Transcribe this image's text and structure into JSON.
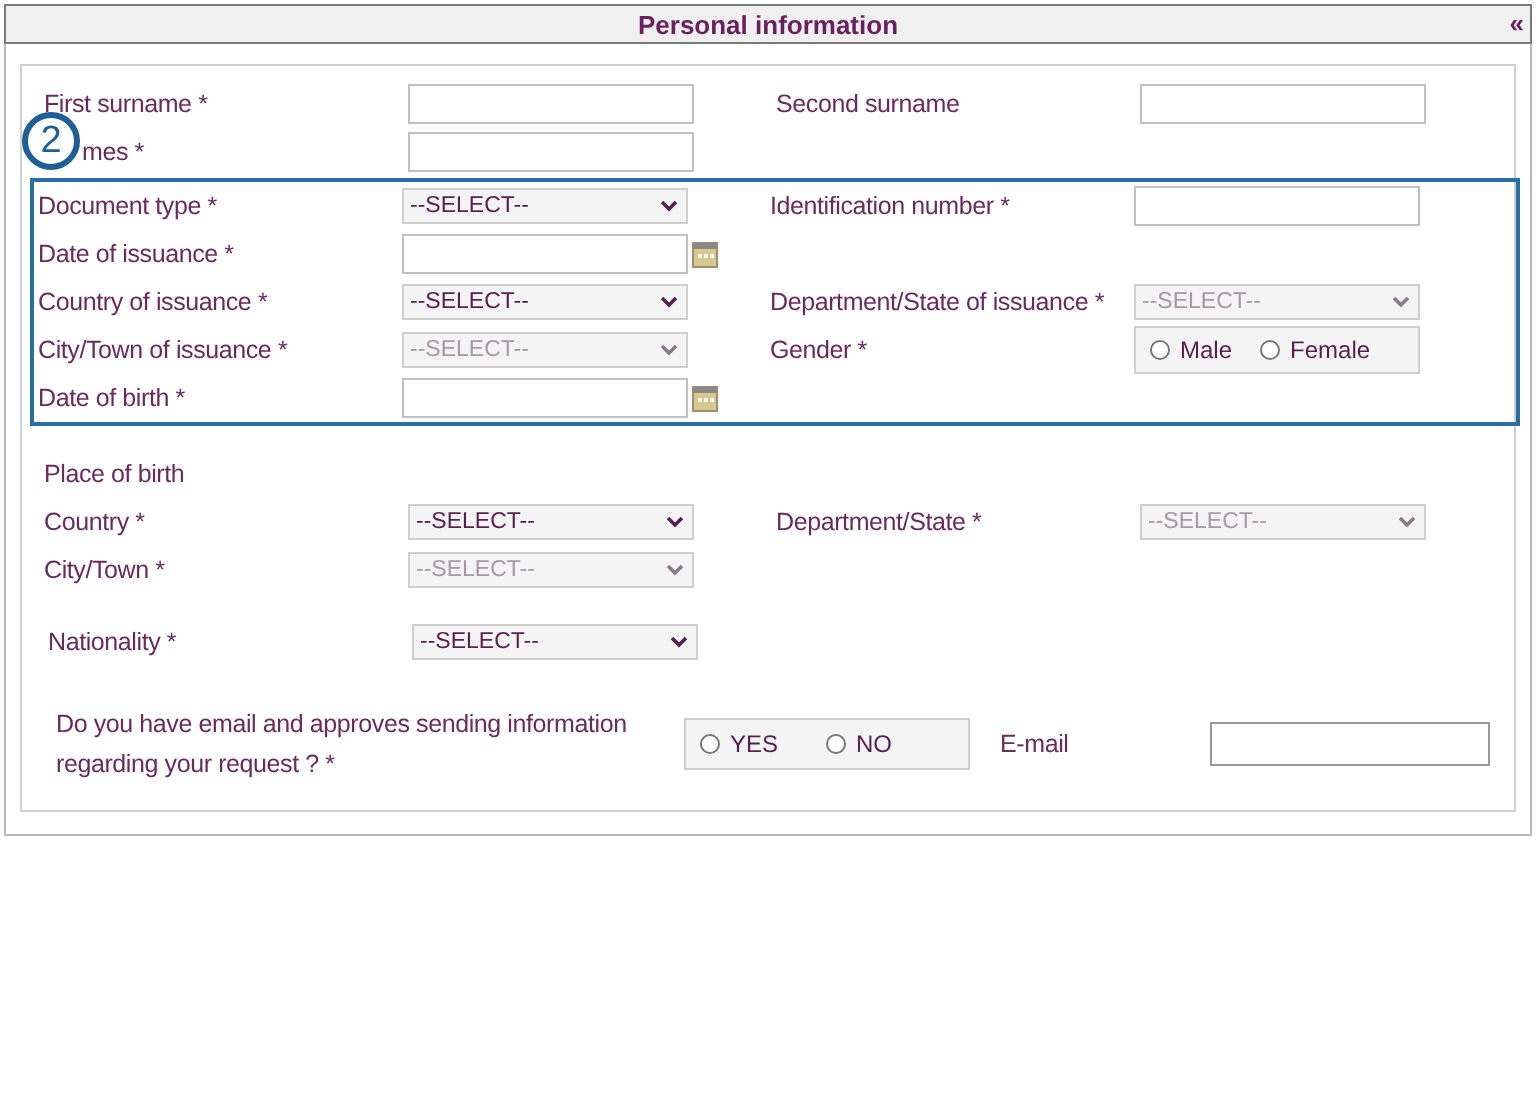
{
  "panel": {
    "title": "Personal information",
    "collapse_icon": "«"
  },
  "groups": [
    {
      "highlighted": false,
      "rows": [
        {
          "kind": "fields",
          "fields": [
            {
              "label": "First surname *",
              "control": {
                "kind": "text"
              }
            },
            {
              "label": "Second surname",
              "control": {
                "kind": "text"
              }
            }
          ]
        },
        {
          "kind": "indented",
          "fields": [
            {
              "label": "mes *",
              "control": {
                "kind": "text"
              }
            }
          ]
        }
      ]
    },
    {
      "highlighted": true,
      "badge": "2",
      "rows": [
        {
          "kind": "fields",
          "fields": [
            {
              "label": "Document type *",
              "control": {
                "kind": "select",
                "value": "--SELECT--",
                "disabled": false
              }
            },
            {
              "label": "Identification number *",
              "control": {
                "kind": "text"
              }
            }
          ]
        },
        {
          "kind": "fields",
          "fields": [
            {
              "label": "Date of issuance *",
              "control": {
                "kind": "date"
              }
            }
          ]
        },
        {
          "kind": "fields",
          "fields": [
            {
              "label": "Country of issuance *",
              "control": {
                "kind": "select",
                "value": "--SELECT--",
                "disabled": false
              }
            },
            {
              "label": "Department/State of issuance *",
              "control": {
                "kind": "select",
                "value": "--SELECT--",
                "disabled": true
              }
            }
          ]
        },
        {
          "kind": "fields",
          "fields": [
            {
              "label": "City/Town of issuance *",
              "control": {
                "kind": "select",
                "value": "--SELECT--",
                "disabled": true
              }
            },
            {
              "label": "Gender *",
              "control": {
                "kind": "radio",
                "options": [
                  {
                    "label": "Male",
                    "selected": false
                  },
                  {
                    "label": "Female",
                    "selected": false
                  }
                ]
              }
            }
          ]
        },
        {
          "kind": "fields",
          "fields": [
            {
              "label": "Date of birth *",
              "control": {
                "kind": "date"
              }
            }
          ]
        }
      ]
    },
    {
      "highlighted": false,
      "rows": [
        {
          "kind": "heading",
          "text": "Place of birth"
        },
        {
          "kind": "fields",
          "fields": [
            {
              "label": "Country *",
              "control": {
                "kind": "select",
                "value": "--SELECT--",
                "disabled": false
              }
            },
            {
              "label": "Department/State *",
              "control": {
                "kind": "select",
                "value": "--SELECT--",
                "disabled": true
              }
            }
          ]
        },
        {
          "kind": "fields",
          "fields": [
            {
              "label": "City/Town *",
              "control": {
                "kind": "select",
                "value": "--SELECT--",
                "disabled": true
              }
            }
          ]
        },
        {
          "kind": "spaced",
          "fields": [
            {
              "label": "Nationality *",
              "control": {
                "kind": "select",
                "value": "--SELECT--",
                "disabled": false
              }
            }
          ]
        },
        {
          "kind": "question",
          "fields": [
            {
              "label": "Do you have email and approves sending information regarding your request ? *",
              "control": {
                "kind": "radio",
                "options": [
                  {
                    "label": "YES",
                    "selected": false
                  },
                  {
                    "label": "NO",
                    "selected": false
                  }
                ]
              }
            },
            {
              "label": "E-mail",
              "control": {
                "kind": "text"
              }
            }
          ]
        }
      ]
    }
  ]
}
